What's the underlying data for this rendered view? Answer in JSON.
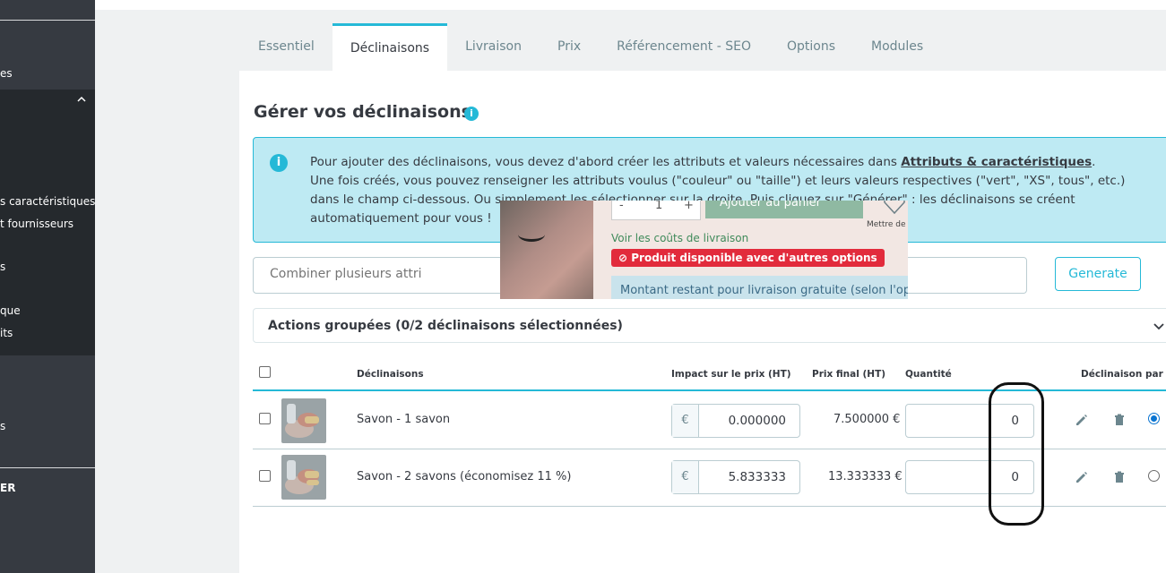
{
  "sidebar": {
    "items": [
      {
        "label": "es",
        "bold": false
      },
      {
        "label": "s caractéristiques",
        "bold": false
      },
      {
        "label": "t fournisseurs",
        "bold": false
      },
      {
        "label": "s",
        "bold": false
      },
      {
        "label": "que",
        "bold": false
      },
      {
        "label": "its",
        "bold": false
      },
      {
        "label": "s",
        "bold": false
      },
      {
        "label": "ER",
        "bold": true
      }
    ]
  },
  "tabs": [
    {
      "label": "Essentiel",
      "active": false
    },
    {
      "label": "Déclinaisons",
      "active": true
    },
    {
      "label": "Livraison",
      "active": false
    },
    {
      "label": "Prix",
      "active": false
    },
    {
      "label": "Référencement - SEO",
      "active": false
    },
    {
      "label": "Options",
      "active": false
    },
    {
      "label": "Modules",
      "active": false
    }
  ],
  "section": {
    "title": "Gérer vos déclinaisons"
  },
  "alert": {
    "line1_before": "Pour ajouter des déclinaisons, vous devez d'abord créer les attributs et valeurs nécessaires dans ",
    "line1_link": "Attributs & caractéristiques",
    "line1_after": ".",
    "rest": "Une fois créés, vous pouvez renseigner les attributs voulus (\"couleur\" ou \"taille\") et leurs valeurs respectives (\"vert\", \"XS\", tous\", etc.) dans le champ ci-dessous. Ou simplement les sélectionner sur la droite. Puis cliquez sur \"Générer\" : les déclinaisons se créent automatiquement pour vous !"
  },
  "combine": {
    "placeholder": "Combiner plusieurs attrib"
  },
  "generate_label": "Generate",
  "bulk_actions_label": "Actions groupées (0/2 déclinaisons sélectionnées)",
  "table": {
    "headers": {
      "combination": "Déclinaisons",
      "impact": "Impact sur le prix (HT)",
      "final": "Prix final (HT)",
      "quantity": "Quantité",
      "default": "Déclinaison par défaut"
    },
    "rows": [
      {
        "name": "Savon - 1 savon",
        "currency": "€",
        "impact": "0.000000",
        "final": "7.500000 €",
        "quantity": "0",
        "is_default": true
      },
      {
        "name": "Savon - 2 savons (économisez 11 %)",
        "currency": "€",
        "impact": "5.833333",
        "final": "13.333333 €",
        "quantity": "0",
        "is_default": false
      }
    ]
  },
  "overlay": {
    "stepper_minus": "-",
    "stepper_value": "1",
    "stepper_plus": "+",
    "cart_label": "Ajouter au panier",
    "wishlist_label": "Mettre de",
    "shipping_link": "Voir les coûts de livraison",
    "badge_label": "Produit disponible avec d'autres options",
    "free_shipping": "Montant restant pour livraison gratuite (selon l'optio"
  },
  "colors": {
    "accent": "#25b9d7",
    "sidebar": "#363a41",
    "danger": "#e22b3c"
  }
}
